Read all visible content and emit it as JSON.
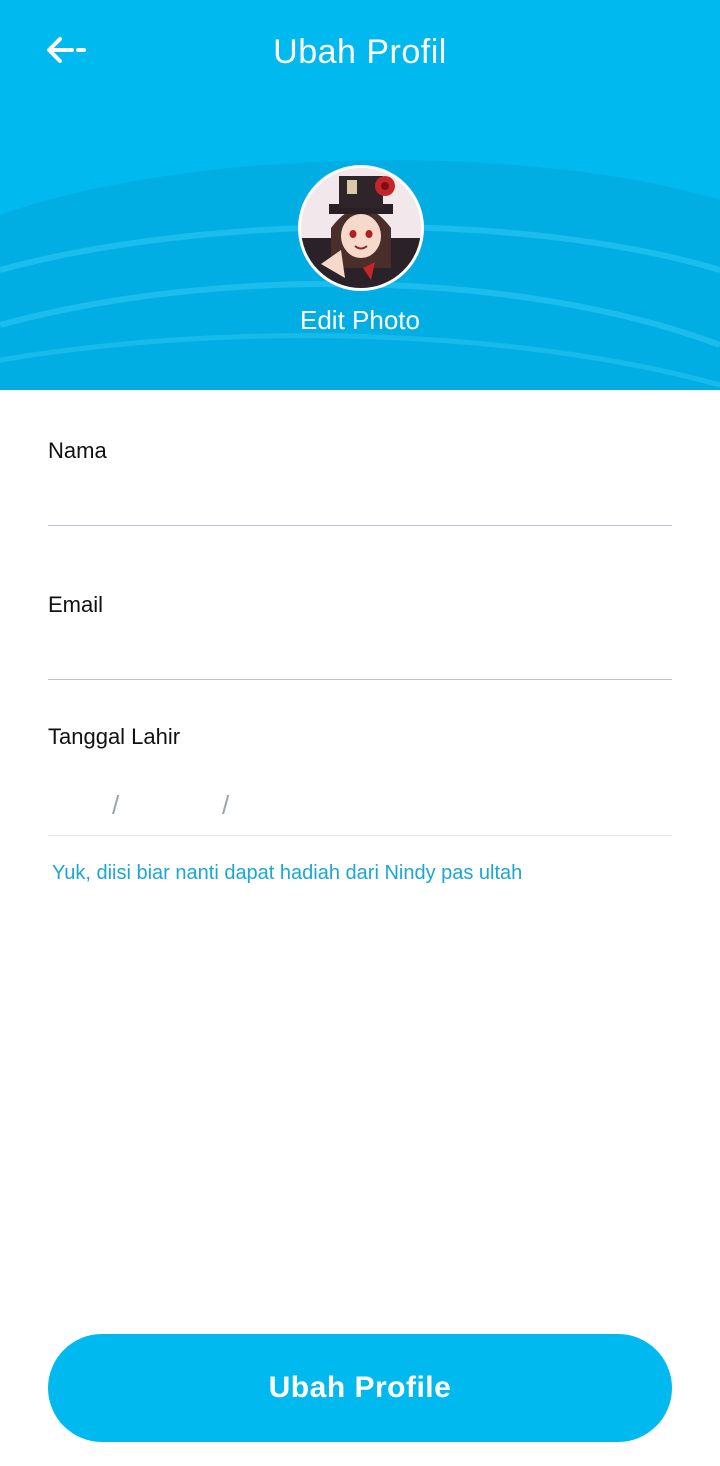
{
  "header": {
    "title": "Ubah Profil",
    "back_icon": "arrow-left-icon",
    "edit_photo_label": "Edit Photo",
    "avatar_alt": "profile-avatar"
  },
  "form": {
    "name": {
      "label": "Nama",
      "value": ""
    },
    "email": {
      "label": "Email",
      "value": ""
    },
    "dob": {
      "label": "Tanggal Lahir",
      "day": "",
      "month": "",
      "year": "",
      "separator": "/"
    },
    "hint": "Yuk, diisi biar nanti dapat hadiah dari Nindy pas ultah"
  },
  "submit_label": "Ubah Profile",
  "colors": {
    "primary": "#00b9ef",
    "hint": "#1aa6d6",
    "divider": "#b9c4cc"
  }
}
